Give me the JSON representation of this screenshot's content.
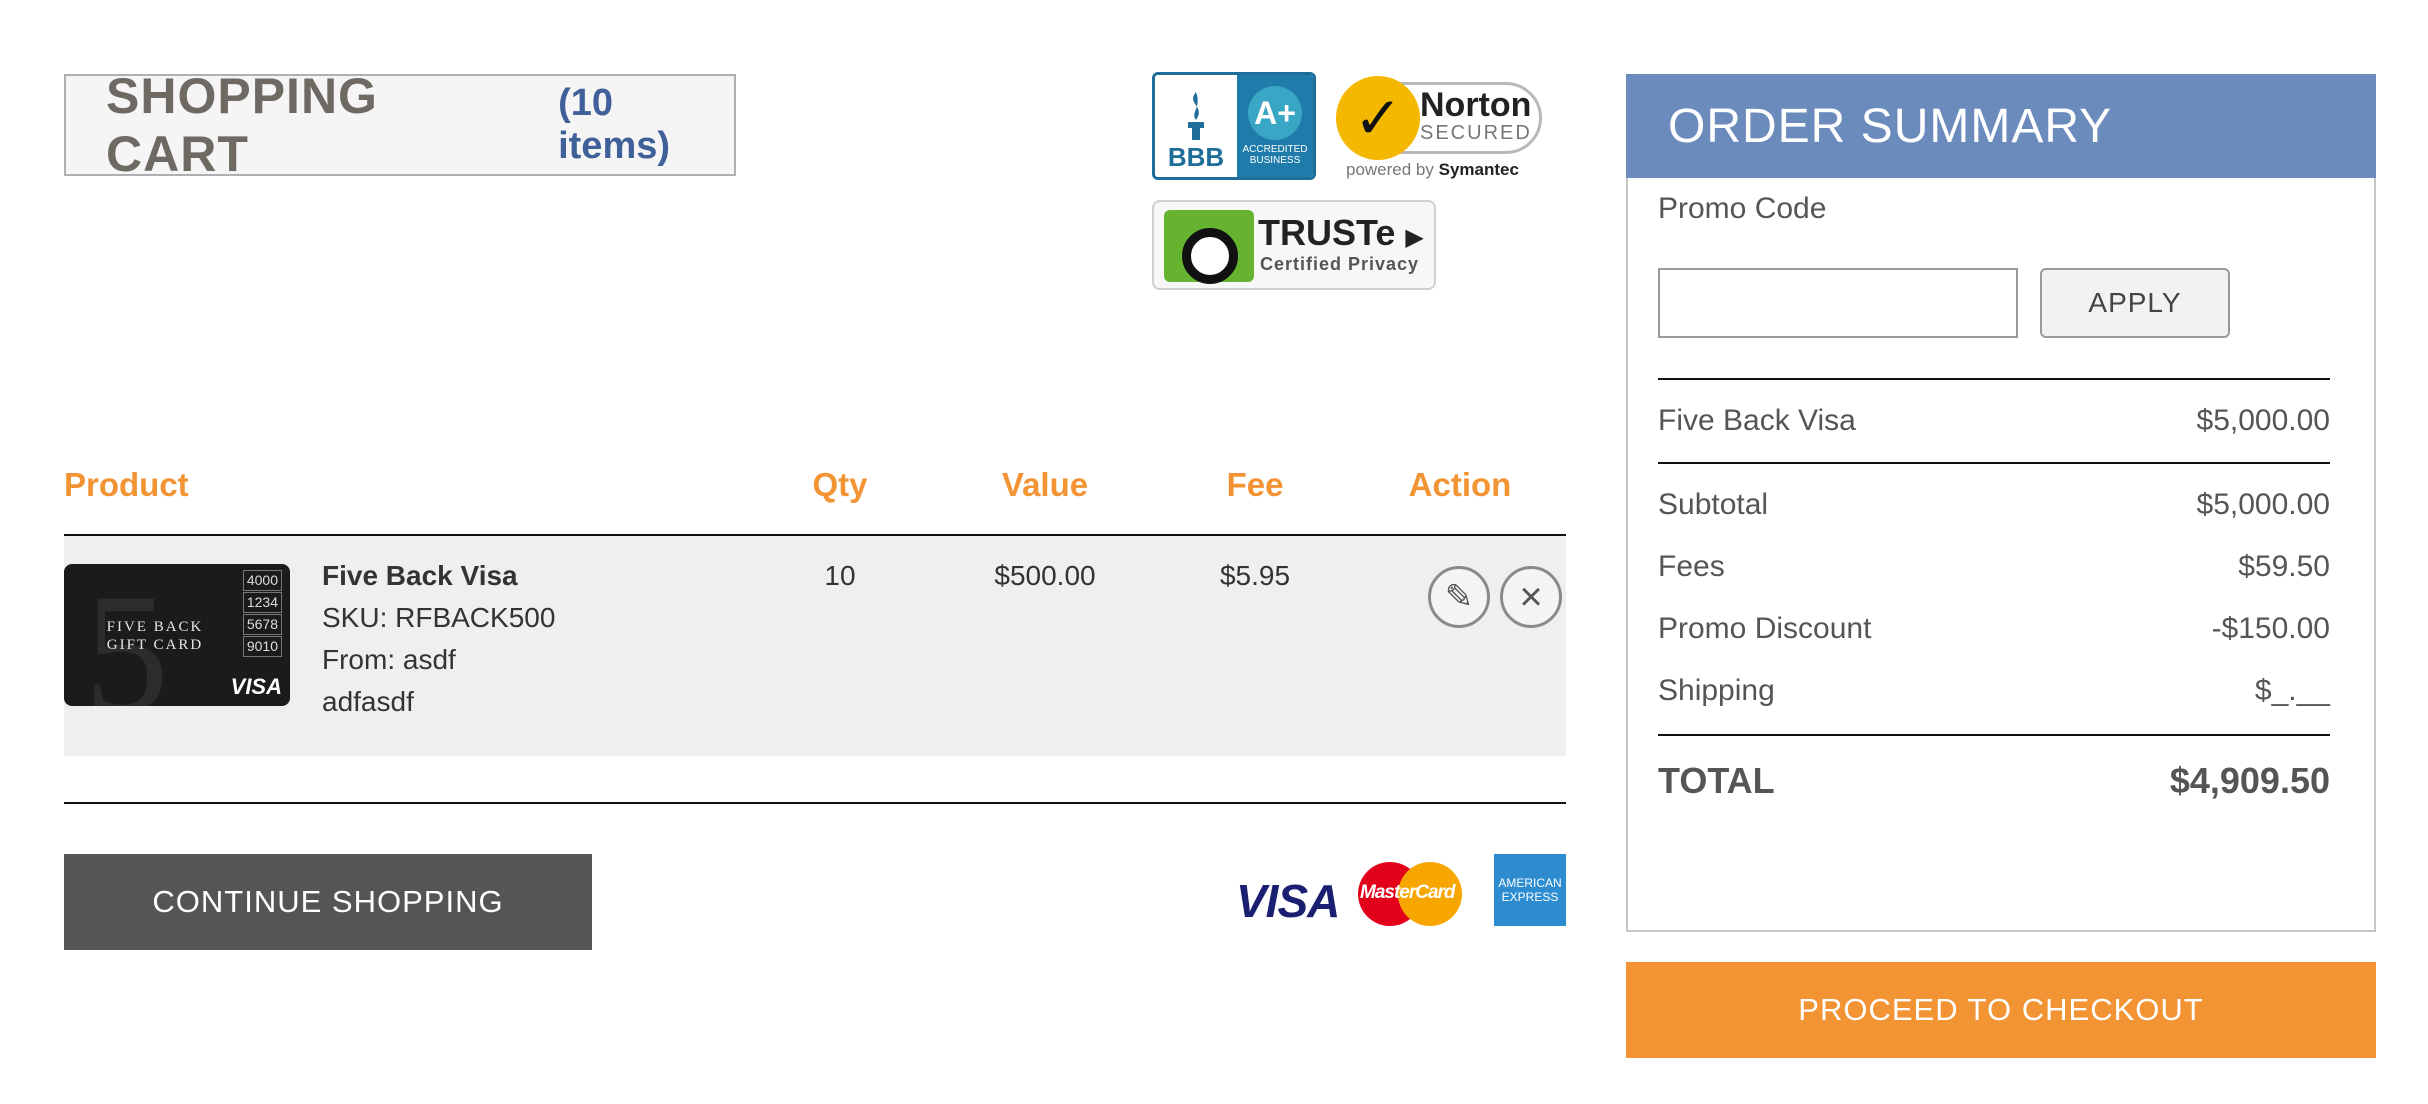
{
  "cart": {
    "title": "SHOPPING CART",
    "count": "(10 items)"
  },
  "badges": {
    "bbb": {
      "rating": "A+",
      "sub": "ACCREDITED BUSINESS",
      "mark": "BBB"
    },
    "norton": {
      "name": "Norton",
      "status": "SECURED",
      "powered_prefix": "powered by",
      "powered_brand": "Symantec"
    },
    "truste": {
      "name": "TRUSTe",
      "sub": "Certified Privacy"
    }
  },
  "table": {
    "headers": {
      "product": "Product",
      "qty": "Qty",
      "value": "Value",
      "fee": "Fee",
      "action": "Action"
    },
    "rows": [
      {
        "name": "Five Back Visa",
        "sku": "SKU: RFBACK500",
        "from": "From: asdf",
        "message": "adfasdf",
        "qty": "10",
        "value": "$500.00",
        "fee": "$5.95",
        "card": {
          "digit": "5",
          "title": "FIVE BACK GIFT CARD",
          "numbers": [
            "4000",
            "1234",
            "5678",
            "9010"
          ],
          "network": "VISA"
        }
      }
    ]
  },
  "buttons": {
    "continue": "CONTINUE SHOPPING",
    "apply": "APPLY",
    "checkout": "PROCEED TO CHECKOUT"
  },
  "payment_logos": {
    "visa": "VISA",
    "mastercard": "MasterCard",
    "amex": "AMERICAN EXPRESS"
  },
  "summary": {
    "title": "ORDER SUMMARY",
    "promo_label": "Promo Code",
    "promo_value": "",
    "items": [
      {
        "label": "Five Back Visa",
        "amount": "$5,000.00"
      }
    ],
    "subtotal": {
      "label": "Subtotal",
      "amount": "$5,000.00"
    },
    "fees": {
      "label": "Fees",
      "amount": "$59.50"
    },
    "discount": {
      "label": "Promo Discount",
      "amount": "-$150.00"
    },
    "shipping": {
      "label": "Shipping",
      "amount": "$_.__"
    },
    "total": {
      "label": "TOTAL",
      "amount": "$4,909.50"
    }
  },
  "colors": {
    "accent": "#f29433",
    "summary_header": "#6b8bbd",
    "count": "#40609a",
    "dark_button": "#555555"
  }
}
